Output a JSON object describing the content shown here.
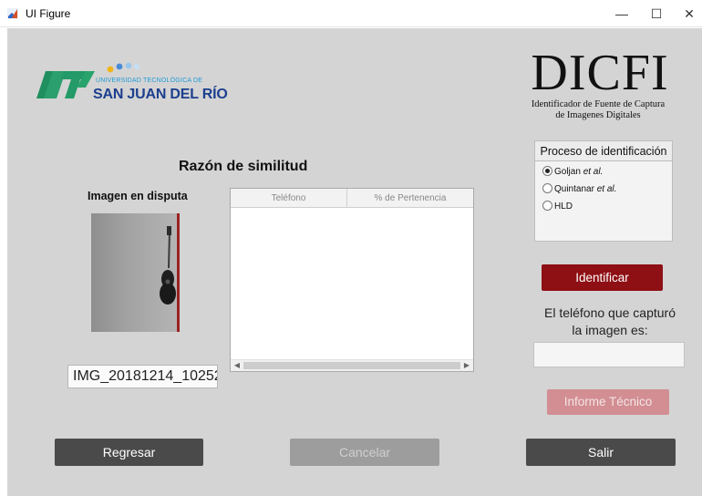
{
  "window": {
    "title": "UI Figure",
    "controls": {
      "minimize": "—",
      "maximize": "☐",
      "close": "✕"
    }
  },
  "logos": {
    "university": {
      "line1": "UNIVERSIDAD TECNOLÓGICA DE",
      "line2": "SAN JUAN DEL RÍO"
    },
    "dicfi": {
      "title": "DICFI",
      "subtitle_line1": "Identificador de Fuente de Captura",
      "subtitle_line2": "de Imagenes Digitales"
    }
  },
  "similarity": {
    "title": "Razón de similitud",
    "table": {
      "columns": [
        "Teléfono",
        "% de Pertenencia"
      ],
      "rows": []
    }
  },
  "disputed": {
    "title": "Imagen en disputa",
    "filename": "IMG_20181214_10252"
  },
  "identification": {
    "title": "Proceso de identificación",
    "options": [
      {
        "name": "Goljan",
        "suffix": "et al.",
        "selected": true
      },
      {
        "name": "Quintanar",
        "suffix": "et al.",
        "selected": false
      },
      {
        "name": "HLD",
        "suffix": "",
        "selected": false
      }
    ]
  },
  "actions": {
    "identify": "Identificar",
    "result_label_line1": "El teléfono que capturó",
    "result_label_line2": "la imagen es:",
    "result_value": "",
    "report": "Informe Técnico",
    "back": "Regresar",
    "cancel": "Cancelar",
    "exit": "Salir"
  },
  "colors": {
    "figure_bg": "#d4d4d4",
    "identify_button": "#8e0f14",
    "report_button_disabled": "#d28e93",
    "dark_button": "#4a4a4a",
    "disabled_button": "#9d9d9d"
  }
}
